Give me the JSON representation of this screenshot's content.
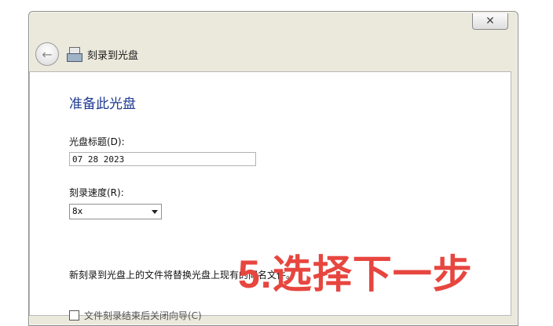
{
  "window": {
    "close_glyph": "✕",
    "title": "刻录到光盘"
  },
  "panel": {
    "heading": "准备此光盘",
    "disc_title_label": "光盘标题(D):",
    "disc_title_value": "07 28 2023",
    "speed_label": "刻录速度(R):",
    "speed_value": "8x",
    "replace_note": "新刻录到光盘上的文件将替换光盘上现有的同名文件。",
    "close_wizard_checkbox_label": "文件刻录结束后关闭向导(C)"
  },
  "overlay": {
    "text": "5.选择下一步",
    "color": "#e7463f"
  },
  "icons": [
    "back-arrow-icon",
    "burn-disc-icon",
    "close-icon",
    "chevron-down-icon"
  ]
}
